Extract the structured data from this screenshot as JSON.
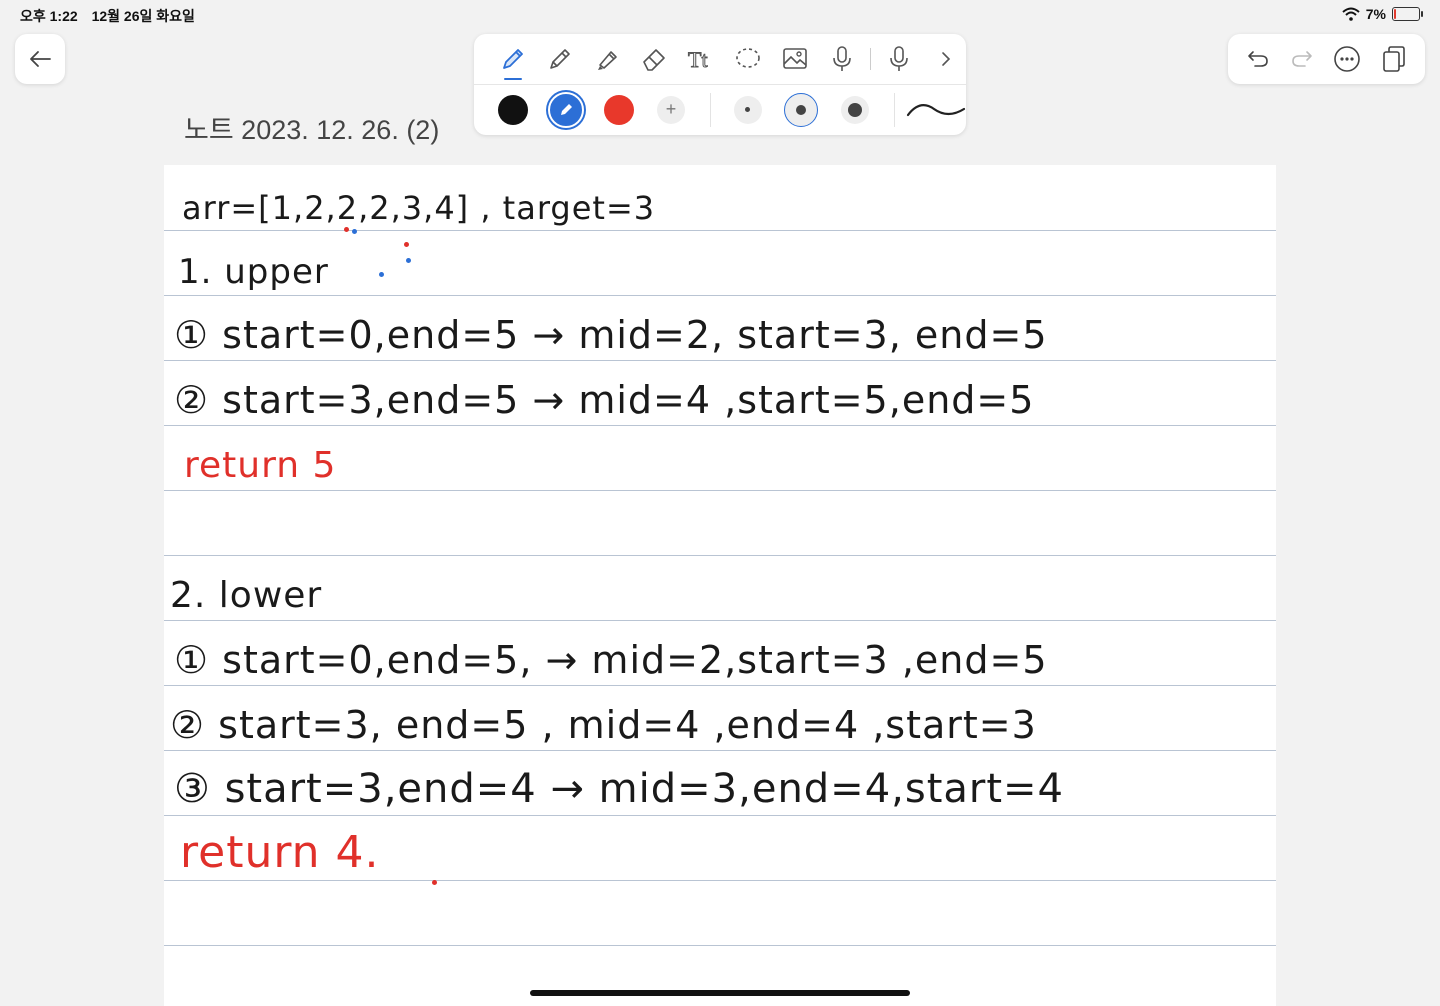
{
  "status_bar": {
    "time": "오후 1:22",
    "date": "12월 26일 화요일",
    "battery": "7%",
    "battery_level": 0.07
  },
  "note": {
    "title": "노트 2023. 12. 26. (2)"
  },
  "toolbar": {
    "tools": [
      "pen-icon",
      "pencil-icon",
      "highlighter-icon",
      "eraser-icon",
      "text-icon",
      "lasso-icon",
      "image-icon",
      "mic-icon",
      "mic-icon",
      "chevron-right-icon"
    ],
    "colors": [
      "#111111",
      "#2c6fd6",
      "#e8382b"
    ],
    "add_color_label": "+"
  },
  "colors": {
    "ink": "#1a1a1a",
    "red_ink": "#e0302a",
    "accent": "#2c6fd6",
    "rule": "#b9c4d3"
  },
  "lines": [
    {
      "text": "arr=[1,2,2,2,3,4] , target=3",
      "color": "ink"
    },
    {
      "text": "1. upper",
      "color": "ink"
    },
    {
      "text": "① start=0,end=5 → mid=2, start=3, end=5",
      "color": "ink"
    },
    {
      "text": "② start=3,end=5 → mid=4 ,start=5,end=5",
      "color": "ink"
    },
    {
      "text": "return 5",
      "color": "red_ink"
    },
    {
      "text": "",
      "color": "ink"
    },
    {
      "text": "2. lower",
      "color": "ink"
    },
    {
      "text": "① start=0,end=5, → mid=2,start=3 ,end=5",
      "color": "ink"
    },
    {
      "text": "② start=3, end=5 , mid=4 ,end=4 ,start=3",
      "color": "ink"
    },
    {
      "text": "③ start=3,end=4 → mid=3,end=4,start=4",
      "color": "ink"
    },
    {
      "text": "return 4.",
      "color": "red_ink"
    }
  ]
}
